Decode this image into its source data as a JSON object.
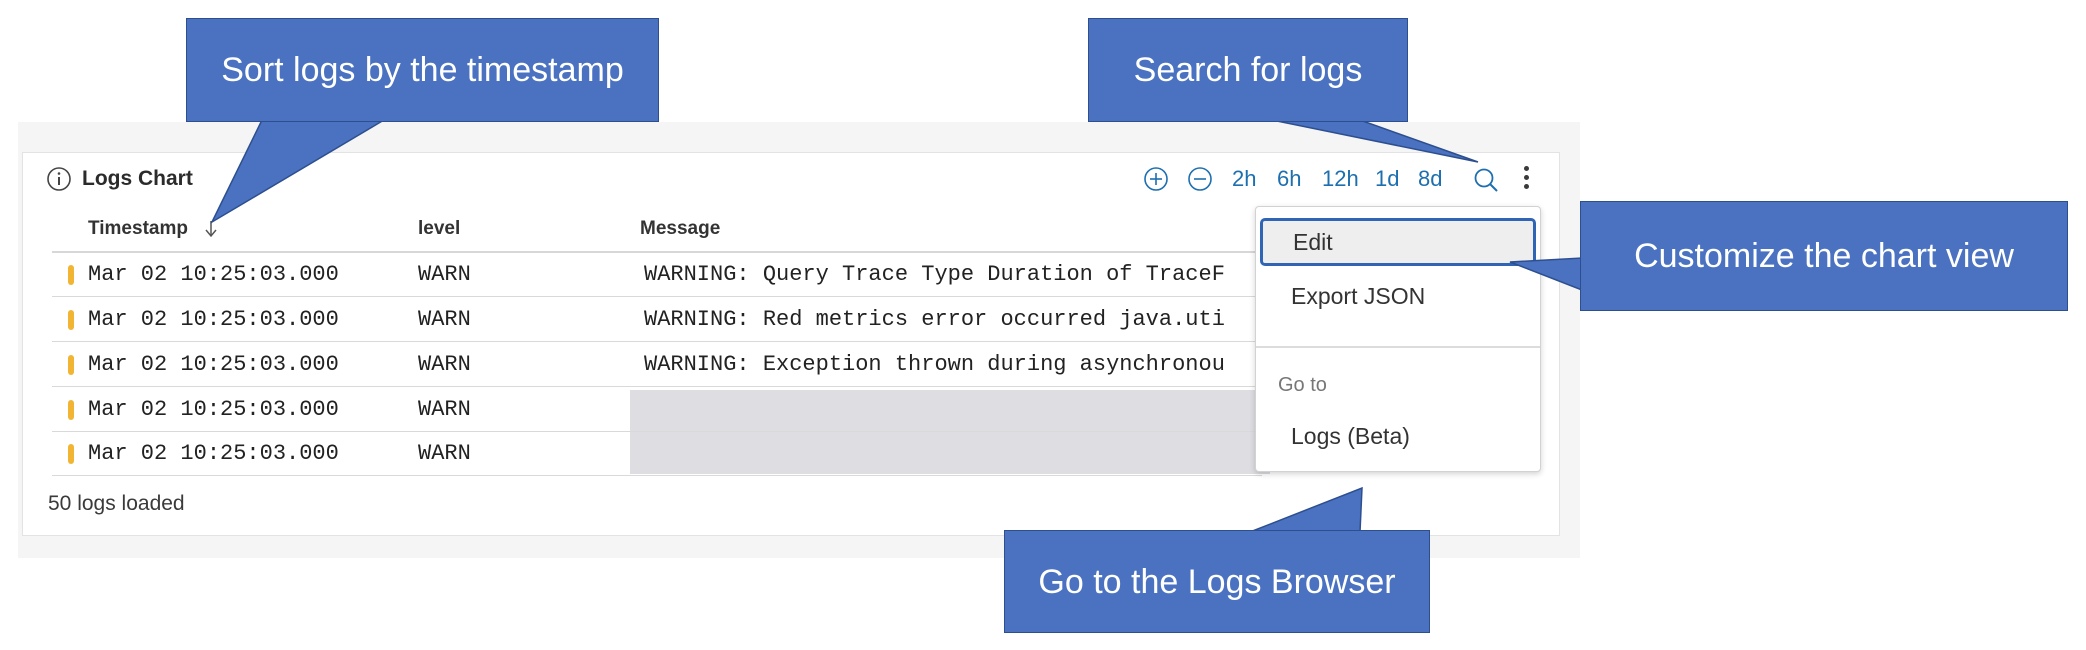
{
  "widget": {
    "title": "Logs Chart",
    "range_buttons": [
      "2h",
      "6h",
      "12h",
      "1d",
      "8d"
    ]
  },
  "table": {
    "columns": [
      "Timestamp",
      "level",
      "Message"
    ],
    "rows": [
      {
        "timestamp": "Mar 02 10:25:03.000",
        "level": "WARN",
        "message": "WARNING: Query Trace Type Duration of TraceF"
      },
      {
        "timestamp": "Mar 02 10:25:03.000",
        "level": "WARN",
        "message": "WARNING: Red metrics error occurred java.uti"
      },
      {
        "timestamp": "Mar 02 10:25:03.000",
        "level": "WARN",
        "message": "WARNING: Exception thrown during asynchronou"
      },
      {
        "timestamp": "Mar 02 10:25:03.000",
        "level": "WARN",
        "message": ""
      },
      {
        "timestamp": "Mar 02 10:25:03.000",
        "level": "WARN",
        "message": ""
      }
    ],
    "footer": "50 logs loaded"
  },
  "menu": {
    "edit": "Edit",
    "export": "Export JSON",
    "group_label": "Go to",
    "logs": "Logs (Beta)"
  },
  "callouts": {
    "sort": "Sort logs by the timestamp",
    "search": "Search for logs",
    "customize": "Customize the chart view",
    "browser": "Go to the Logs Browser"
  },
  "colors": {
    "accent": "#1d6fb0",
    "callout": "#4a72c1",
    "warn": "#f2b533",
    "menu_focus": "#2f65b4"
  },
  "icons": [
    "info-icon",
    "zoom-in-icon",
    "zoom-out-icon",
    "search-icon",
    "kebab-menu-icon",
    "sort-down-icon"
  ]
}
